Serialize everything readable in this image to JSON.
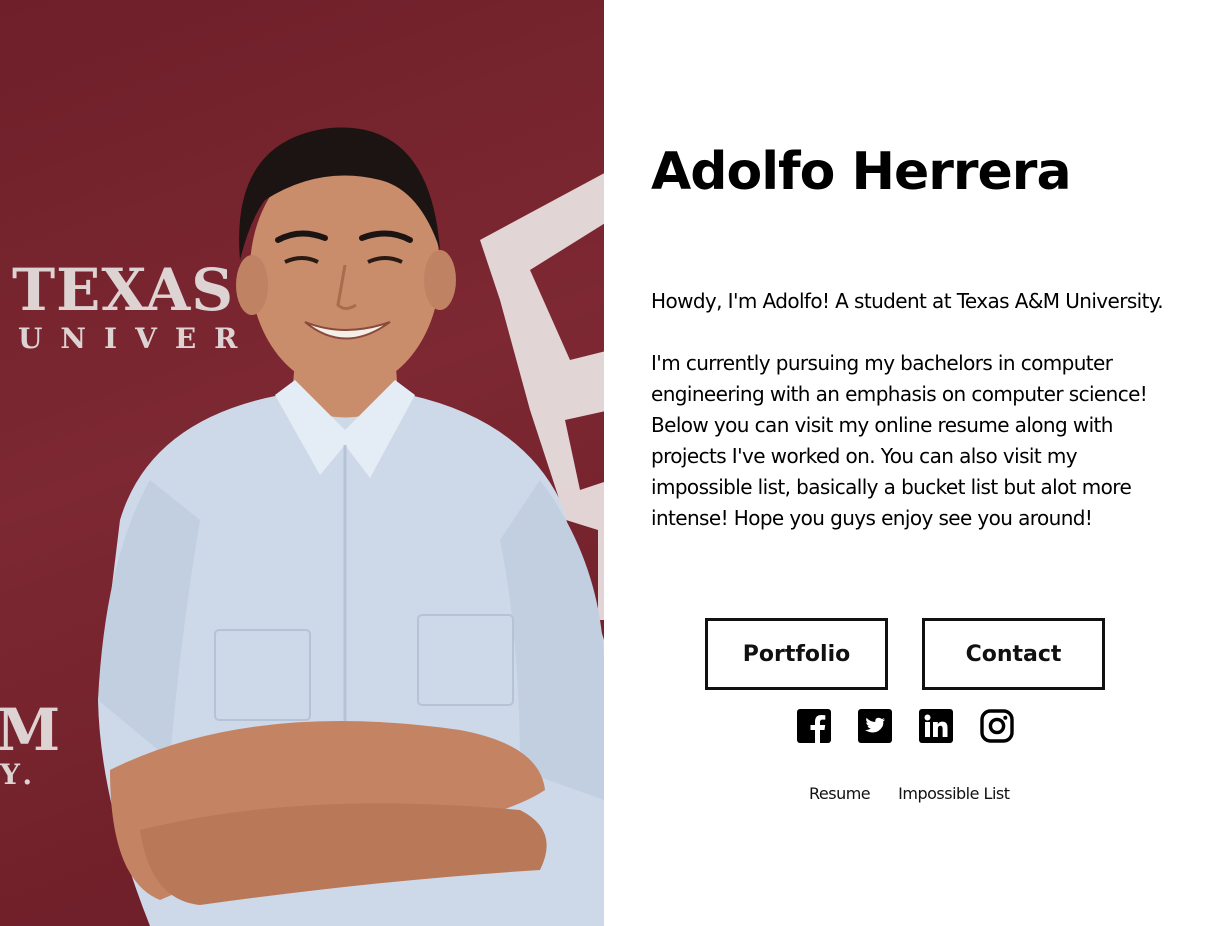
{
  "photo": {
    "backdrop_text_1": "TEXAS",
    "backdrop_text_2": "UNIVER",
    "backdrop_text_3": "M",
    "backdrop_text_4": "Y."
  },
  "profile": {
    "name": "Adolfo Herrera",
    "intro": "Howdy, I'm Adolfo! A student at Texas A&M University.",
    "description": "I'm currently pursuing my bachelors in computer engineering with an emphasis on computer science! Below you can visit my online resume along with projects I've worked on. You can also visit my impossible list, basically a bucket list but alot more intense! Hope you guys enjoy see you around!"
  },
  "buttons": {
    "portfolio": "Portfolio",
    "contact": "Contact"
  },
  "socials": [
    {
      "icon": "facebook-icon"
    },
    {
      "icon": "twitter-icon"
    },
    {
      "icon": "linkedin-icon"
    },
    {
      "icon": "instagram-icon"
    }
  ],
  "links": {
    "resume": "Resume",
    "impossible_list": "Impossible List"
  },
  "colors": {
    "backdrop": "#7d2832",
    "text": "#000000",
    "background": "#ffffff"
  }
}
